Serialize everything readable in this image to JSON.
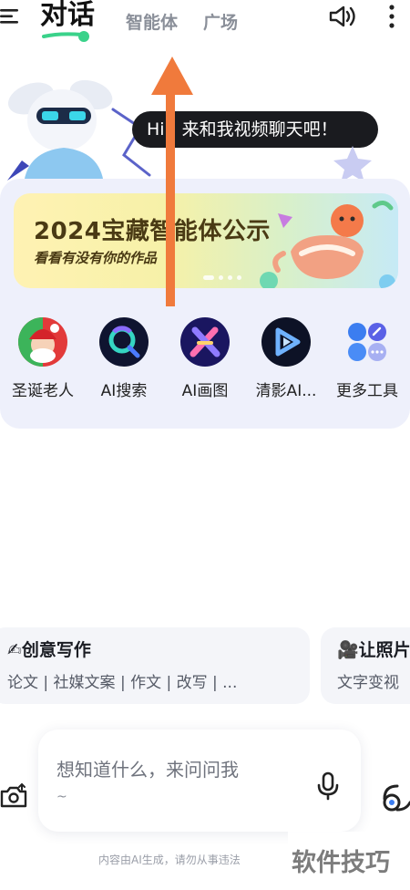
{
  "header": {
    "tab_active": "对话",
    "tab_agent": "智能体",
    "tab_square": "广场",
    "icons": [
      "menu-icon",
      "speaker-icon",
      "more-vertical-icon"
    ]
  },
  "hero": {
    "greeting": "Hi，来和我视频聊天吧！"
  },
  "banner": {
    "title": "2024宝藏智能体公示",
    "subtitle": "看看有没有你的作品"
  },
  "tools": [
    {
      "label": "圣诞老人",
      "icon": "santa-icon"
    },
    {
      "label": "AI搜索",
      "icon": "ai-search-icon"
    },
    {
      "label": "AI画图",
      "icon": "ai-draw-icon"
    },
    {
      "label": "清影AI...",
      "icon": "video-play-icon"
    },
    {
      "label": "更多工具",
      "icon": "more-tools-grid-icon"
    }
  ],
  "suggestions": [
    {
      "title": "✍创意写作",
      "desc": "论文 | 社媒文案 | 作文 | 改写 | ..."
    },
    {
      "title": "🎥让照片",
      "desc": "文字变视"
    }
  ],
  "input": {
    "placeholder": "想知道什么，来问问我",
    "tilde": "~"
  },
  "footer": {
    "disclaimer": "内容由AI生成，请勿从事违法",
    "watermark": "软件技巧"
  },
  "colors": {
    "accent_arrow": "#f07a3c",
    "bubble_bg": "#1a1b1f",
    "card_bg": "#eef0fb",
    "active_dot": "#3ad28a"
  }
}
